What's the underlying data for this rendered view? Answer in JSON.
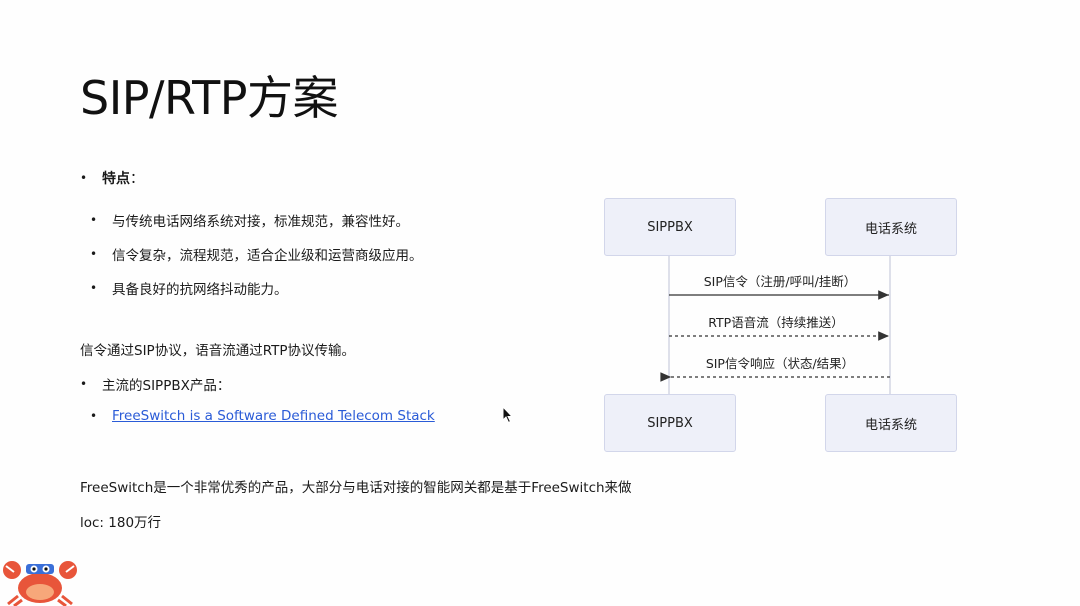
{
  "title": "SIP/RTP方案",
  "features": {
    "label": "特点",
    "colon": "：",
    "items": [
      "与传统电话网络系统对接，标准规范，兼容性好。",
      "信令复杂，流程规范，适合企业级和运营商级应用。",
      "具备良好的抗网络抖动能力。"
    ]
  },
  "paragraph": "信令通过SIP协议，语音流通过RTP协议传输。",
  "products_label": "主流的SIPPBX产品：",
  "link_text": "FreeSwitch is a Software Defined Telecom Stack",
  "paragraph2": "FreeSwitch是一个非常优秀的产品，大部分与电话对接的智能网关都是基于FreeSwitch来做",
  "loc": "loc: 180万行",
  "diagram": {
    "participants": [
      "SIPPBX",
      "电话系统"
    ],
    "messages": [
      {
        "text": "SIP信令（注册/呼叫/挂断）",
        "direction": "right",
        "style": "solid"
      },
      {
        "text": "RTP语音流（持续推送）",
        "direction": "right",
        "style": "dashed"
      },
      {
        "text": "SIP信令响应（状态/结果）",
        "direction": "left",
        "style": "dashed"
      }
    ]
  },
  "colors": {
    "box_fill": "#eef0f9",
    "box_border": "#d2d6ea",
    "link": "#2a5bd7",
    "line": "#333333"
  }
}
